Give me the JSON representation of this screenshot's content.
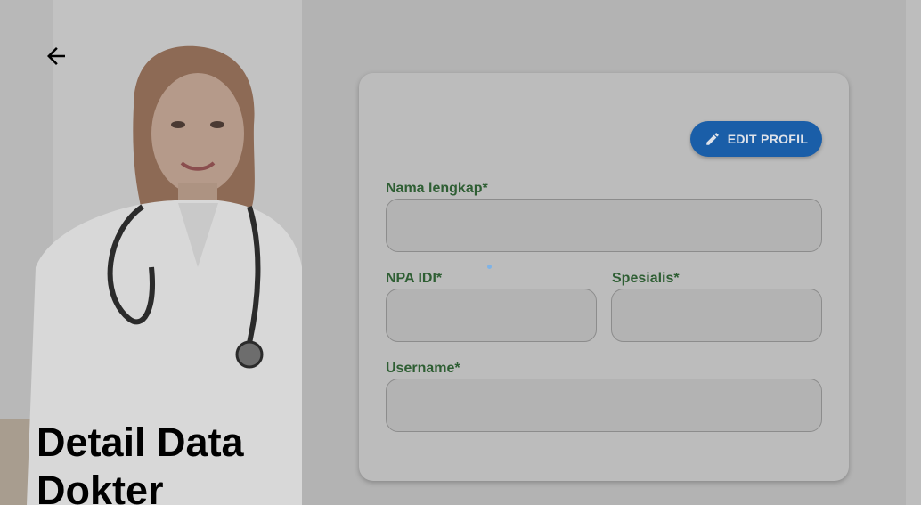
{
  "header": {
    "back_icon": "arrow-left-icon",
    "title": "Detail Data Dokter"
  },
  "profile_card": {
    "edit_button": {
      "label": "EDIT PROFIL",
      "icon": "pencil-icon",
      "color": "#1a5ea8"
    },
    "fields": {
      "full_name": {
        "label": "Nama lengkap*",
        "value": ""
      },
      "npa_idi": {
        "label": "NPA IDI*",
        "value": ""
      },
      "specialist": {
        "label": "Spesialis*",
        "value": ""
      },
      "username": {
        "label": "Username*",
        "value": ""
      }
    },
    "label_color": "#2e5e33"
  },
  "hero": {
    "image": "doctor-portrait"
  }
}
